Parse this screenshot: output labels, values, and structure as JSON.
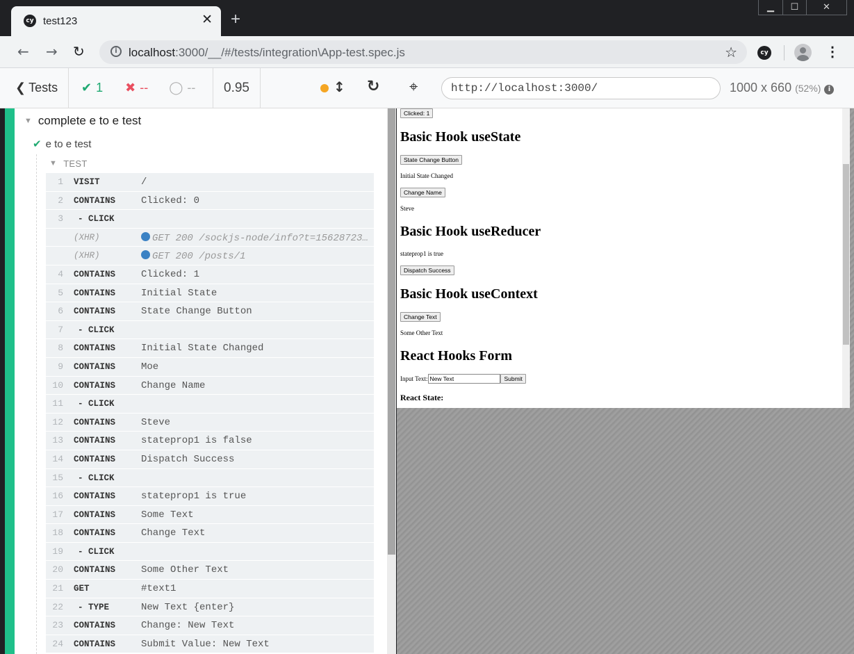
{
  "browser": {
    "tab_title": "test123",
    "tab_favicon": "cy",
    "close_glyph": "✕",
    "newtab_glyph": "+",
    "window_controls": [
      "▁",
      "☐",
      "✕"
    ],
    "back_glyph": "←",
    "forward_glyph": "→",
    "reload_glyph": "↻",
    "url_host": "localhost",
    "url_rest": ":3000/__/#/tests/integration\\App-test.spec.js",
    "info_glyph": "i",
    "star_glyph": "☆",
    "extension_label": "cy",
    "menu_glyph": "⋮"
  },
  "header": {
    "tests_label": "Tests",
    "back_chevron": "❮",
    "passed_icon": "✔",
    "passed_count": "1",
    "failed_icon": "✖",
    "failed_count": "--",
    "pending_icon": "◯",
    "pending_count": "--",
    "duration": "0.95",
    "scroll_icon": "↕",
    "restart_icon": "↻",
    "selector_icon": "⌖",
    "aut_url": "http://localhost:3000/",
    "viewport": "1000 x 660",
    "scale": "(52%)",
    "info_icon": "i",
    "status_colors": {
      "pass": "#1fa971",
      "fail": "#e94f5f",
      "running": "#f5a623"
    }
  },
  "reporter": {
    "suite_title": "complete e to e test",
    "suite_toggle": "▼",
    "test_title": "e to e test",
    "test_check": "✔",
    "hooks_title": "TEST",
    "hooks_toggle": "▼",
    "commands": [
      {
        "num": "1",
        "name": "VISIT",
        "msg": "/",
        "kind": "cmd"
      },
      {
        "num": "2",
        "name": "CONTAINS",
        "msg": "Clicked: 0",
        "kind": "cmd"
      },
      {
        "num": "3",
        "name": "- CLICK",
        "msg": "",
        "kind": "child"
      },
      {
        "num": "",
        "name": "(XHR)",
        "msg": "GET 200 /sockjs-node/info?t=15628723…",
        "kind": "xhr"
      },
      {
        "num": "",
        "name": "(XHR)",
        "msg": "GET 200 /posts/1",
        "kind": "xhr"
      },
      {
        "num": "4",
        "name": "CONTAINS",
        "msg": "Clicked: 1",
        "kind": "cmd"
      },
      {
        "num": "5",
        "name": "CONTAINS",
        "msg": "Initial State",
        "kind": "cmd"
      },
      {
        "num": "6",
        "name": "CONTAINS",
        "msg": "State Change Button",
        "kind": "cmd"
      },
      {
        "num": "7",
        "name": "- CLICK",
        "msg": "",
        "kind": "child"
      },
      {
        "num": "8",
        "name": "CONTAINS",
        "msg": "Initial State Changed",
        "kind": "cmd"
      },
      {
        "num": "9",
        "name": "CONTAINS",
        "msg": "Moe",
        "kind": "cmd"
      },
      {
        "num": "10",
        "name": "CONTAINS",
        "msg": "Change Name",
        "kind": "cmd"
      },
      {
        "num": "11",
        "name": "- CLICK",
        "msg": "",
        "kind": "child"
      },
      {
        "num": "12",
        "name": "CONTAINS",
        "msg": "Steve",
        "kind": "cmd"
      },
      {
        "num": "13",
        "name": "CONTAINS",
        "msg": "stateprop1 is false",
        "kind": "cmd"
      },
      {
        "num": "14",
        "name": "CONTAINS",
        "msg": "Dispatch Success",
        "kind": "cmd"
      },
      {
        "num": "15",
        "name": "- CLICK",
        "msg": "",
        "kind": "child"
      },
      {
        "num": "16",
        "name": "CONTAINS",
        "msg": "stateprop1 is true",
        "kind": "cmd"
      },
      {
        "num": "17",
        "name": "CONTAINS",
        "msg": "Some Text",
        "kind": "cmd"
      },
      {
        "num": "18",
        "name": "CONTAINS",
        "msg": "Change Text",
        "kind": "cmd"
      },
      {
        "num": "19",
        "name": "- CLICK",
        "msg": "",
        "kind": "child"
      },
      {
        "num": "20",
        "name": "CONTAINS",
        "msg": "Some Other Text",
        "kind": "cmd"
      },
      {
        "num": "21",
        "name": "GET",
        "msg": "#text1",
        "kind": "cmd"
      },
      {
        "num": "22",
        "name": "- TYPE",
        "msg": "New Text {enter}",
        "kind": "child"
      },
      {
        "num": "23",
        "name": "CONTAINS",
        "msg": "Change: New Text",
        "kind": "cmd"
      },
      {
        "num": "24",
        "name": "CONTAINS",
        "msg": "Submit Value: New Text",
        "kind": "cmd"
      }
    ]
  },
  "app": {
    "clicked_button": "Clicked: 1",
    "h_usestate": "Basic Hook useState",
    "state_change_button": "State Change Button",
    "initial_state_text": "Initial State Changed",
    "change_name_button": "Change Name",
    "name_text": "Steve",
    "h_usereducer": "Basic Hook useReducer",
    "stateprop_text": "stateprop1 is true",
    "dispatch_button": "Dispatch Success",
    "h_usecontext": "Basic Hook useContext",
    "change_text_button": "Change Text",
    "context_text": "Some Other Text",
    "h_form": "React Hooks Form",
    "input_label": "Input Text:",
    "input_value": "New Text",
    "submit_button": "Submit",
    "react_state_label": "React State:"
  }
}
